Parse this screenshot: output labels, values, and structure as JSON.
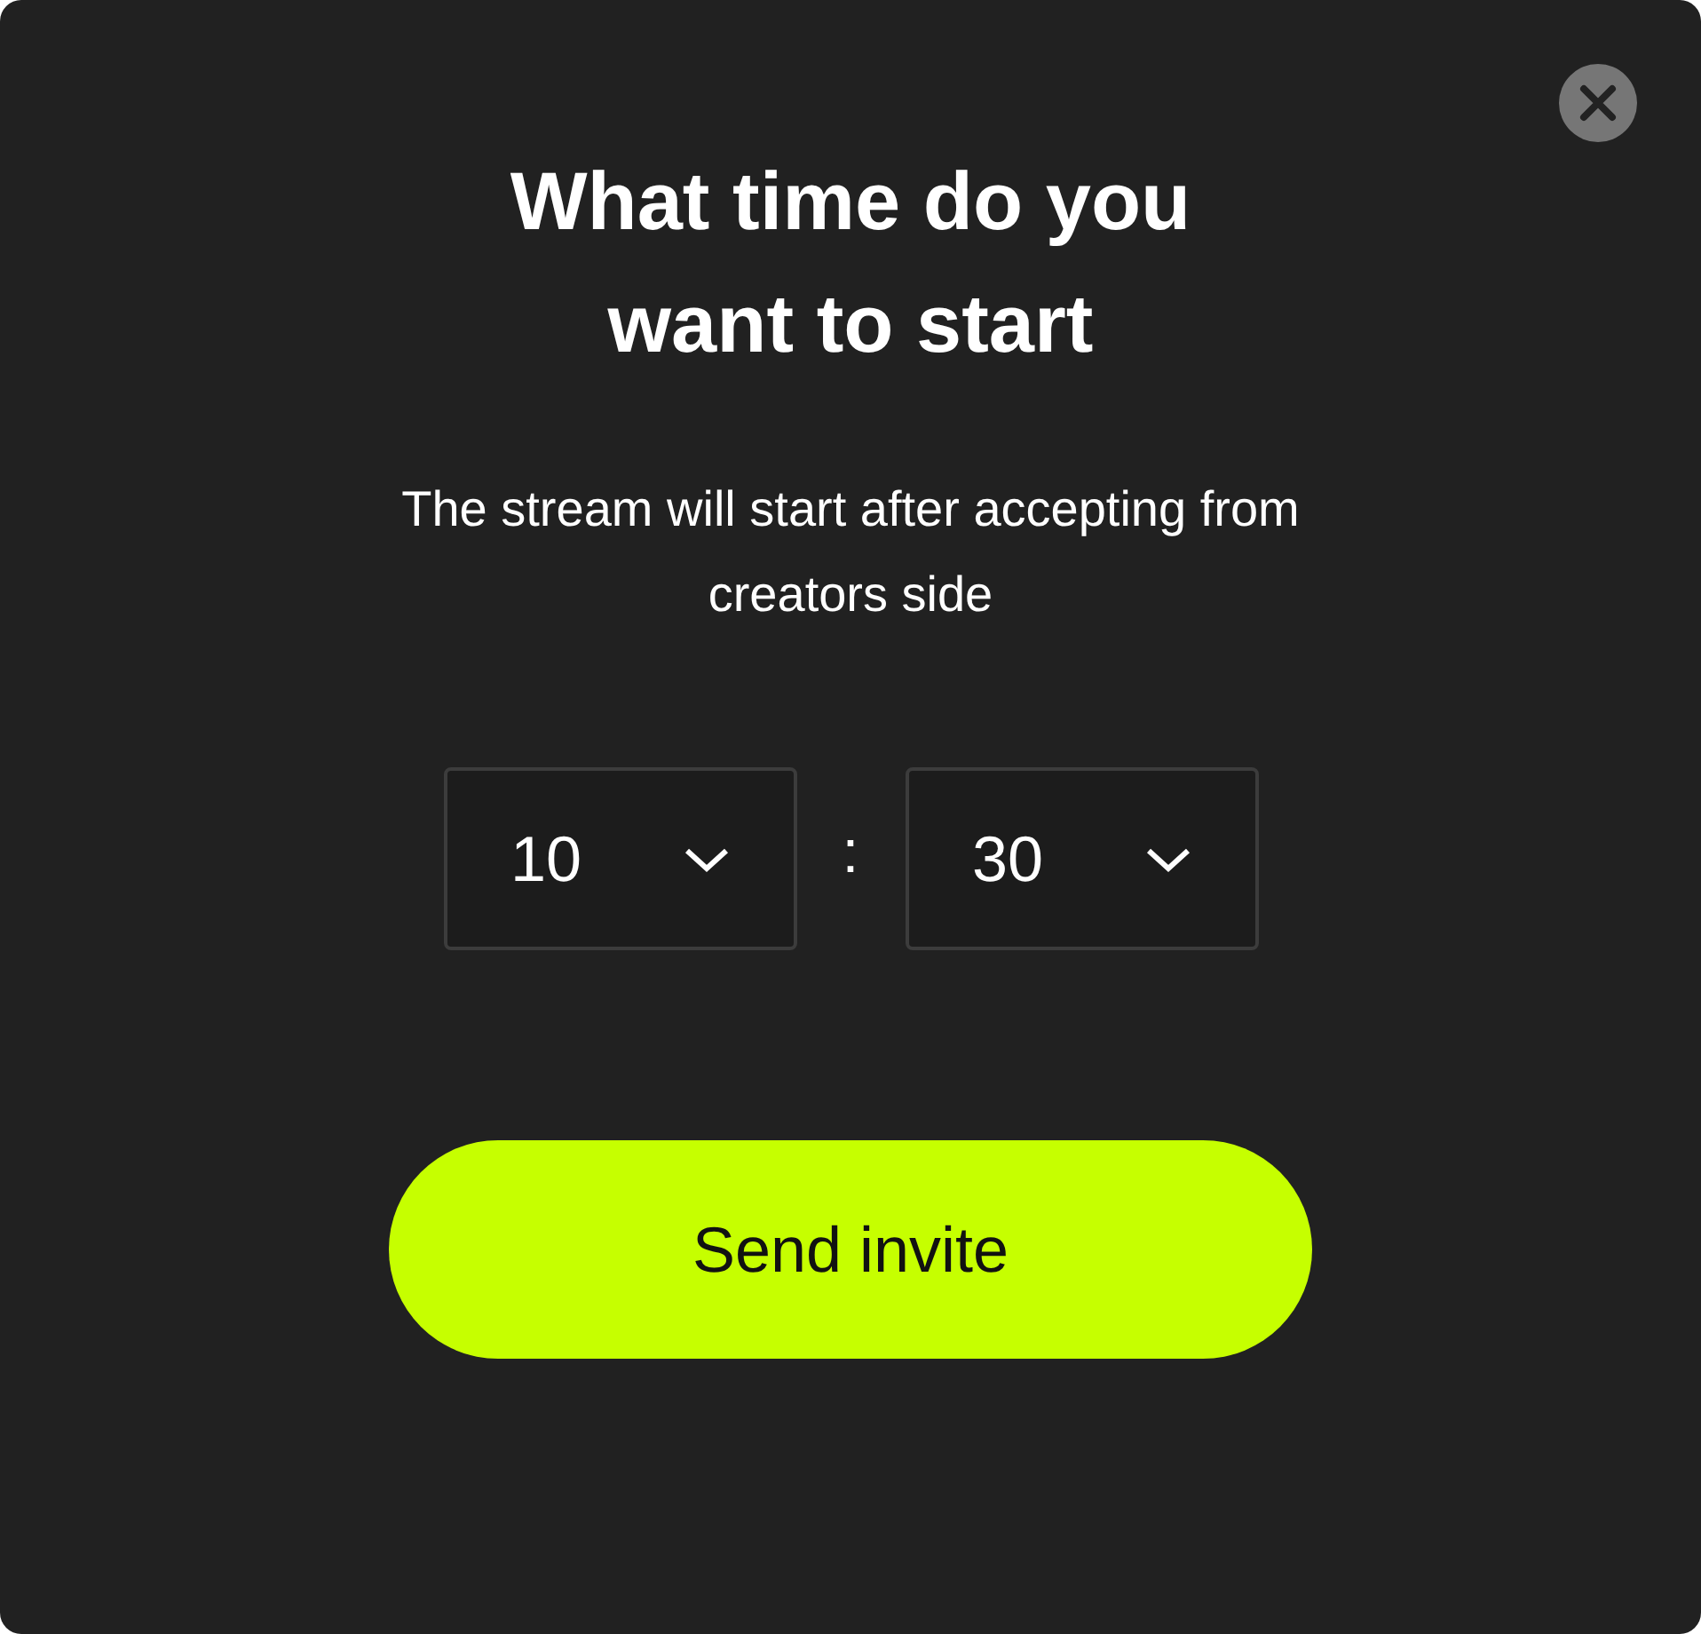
{
  "dialog": {
    "title": "What time do you want to start",
    "subtitle": "The stream will start after accepting from creators side"
  },
  "time": {
    "hour": "10",
    "separator": ":",
    "minute": "30"
  },
  "primary_button": {
    "label": "Send invite"
  }
}
